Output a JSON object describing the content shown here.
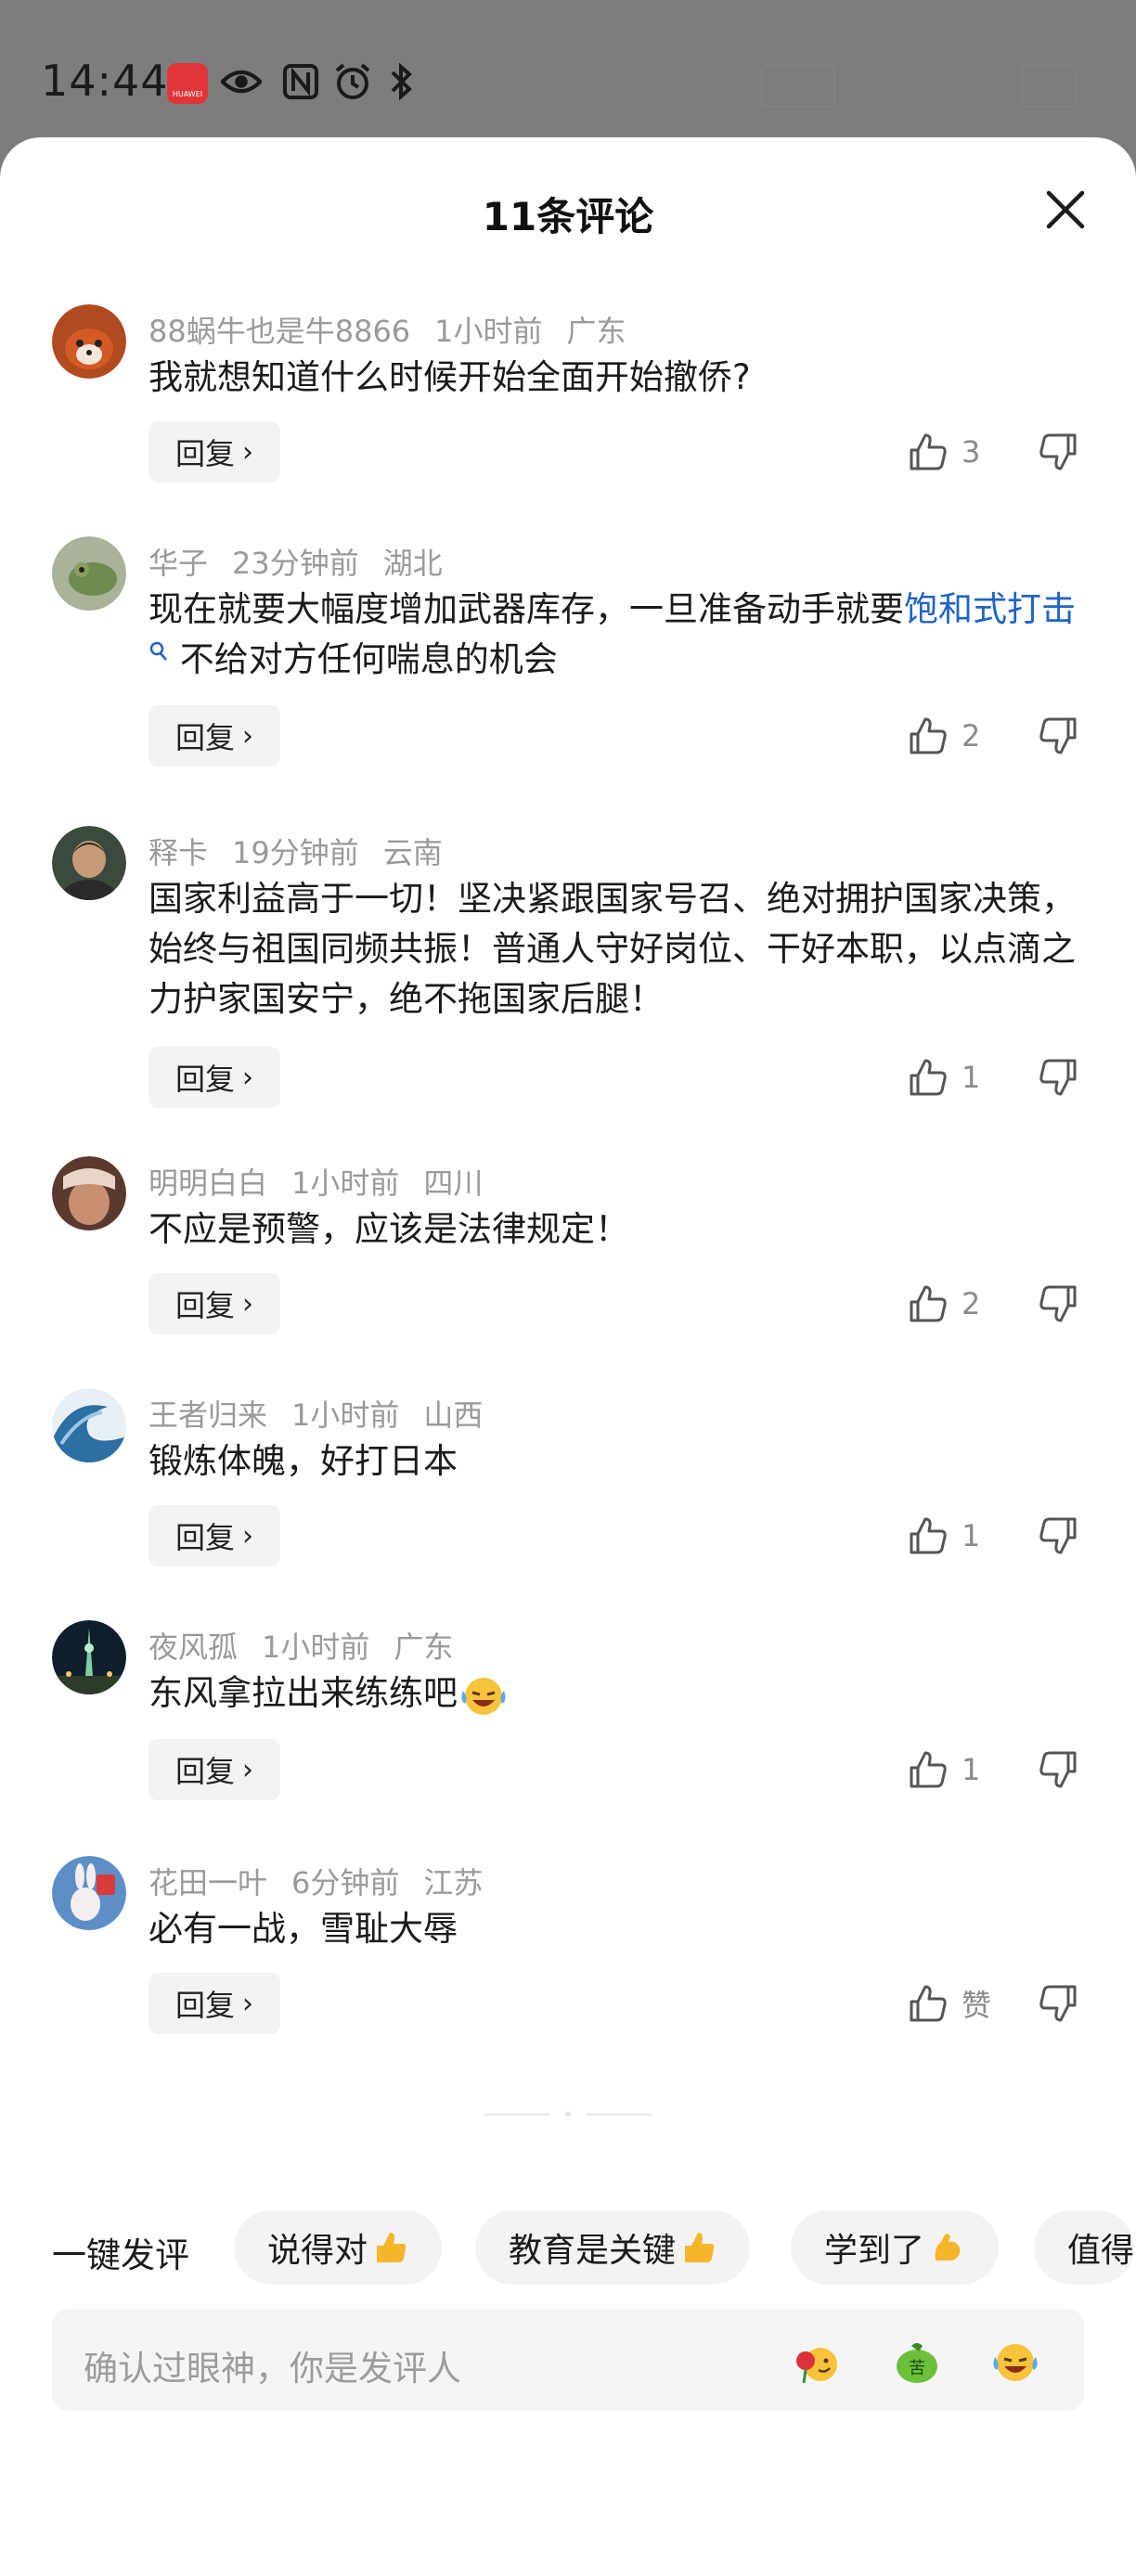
{
  "status_bar": {
    "time": "14:44"
  },
  "sheet": {
    "title": "11条评论"
  },
  "comments": [
    {
      "user": "88蜗牛也是牛8866",
      "time": "1小时前",
      "location": "广东",
      "text": "我就想知道什么时候开始全面开始撤侨?",
      "reply": "回复",
      "likes": "3"
    },
    {
      "user": "华子",
      "time": "23分钟前",
      "location": "湖北",
      "text_before": "现在就要大幅度增加武器库存，一旦准备动手就要",
      "link": "饱和式打击",
      "text_after": "不给对方任何喘息的机会",
      "reply": "回复",
      "likes": "2"
    },
    {
      "user": "释卡",
      "time": "19分钟前",
      "location": "云南",
      "text": "国家利益高于一切！坚决紧跟国家号召、绝对拥护国家决策，始终与祖国同频共振！普通人守好岗位、干好本职，以点滴之力护家国安宁，绝不拖国家后腿！",
      "reply": "回复",
      "likes": "1"
    },
    {
      "user": "明明白白",
      "time": "1小时前",
      "location": "四川",
      "text": "不应是预警，应该是法律规定！",
      "reply": "回复",
      "likes": "2"
    },
    {
      "user": "王者归来",
      "time": "1小时前",
      "location": "山西",
      "text": "锻炼体魄，好打日本",
      "reply": "回复",
      "likes": "1"
    },
    {
      "user": "夜风孤",
      "time": "1小时前",
      "location": "广东",
      "text": "东风拿拉出来练练吧",
      "reply": "回复",
      "likes": "1"
    },
    {
      "user": "花田一叶",
      "time": "6分钟前",
      "location": "江苏",
      "text": "必有一战，雪耻大辱",
      "reply": "回复",
      "likes": "赞"
    }
  ],
  "quick": {
    "label": "一键发评",
    "chips": [
      "说得对",
      "教育是关键",
      "学到了",
      "值得"
    ]
  },
  "input": {
    "placeholder": "确认过眼神，你是发评人"
  }
}
